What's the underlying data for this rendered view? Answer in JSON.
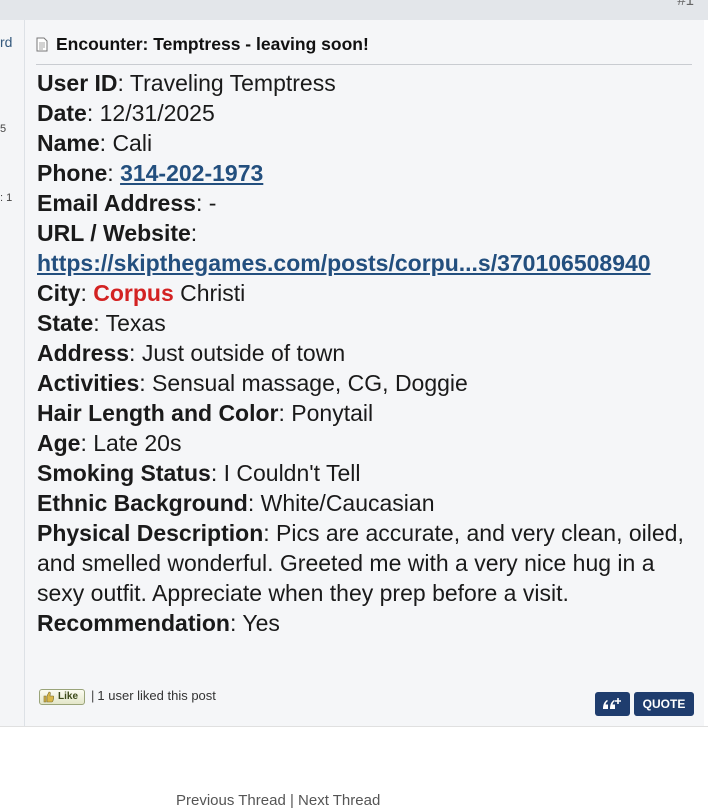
{
  "post": {
    "number": "#1",
    "title": "Encounter: Temptress - leaving soon!",
    "fields": [
      {
        "label": "User ID",
        "value": "Traveling Temptress"
      },
      {
        "label": "Date",
        "value": "12/31/2025"
      },
      {
        "label": "Name",
        "value": "Cali"
      },
      {
        "label": "Phone",
        "value": "314-202-1973"
      },
      {
        "label": "Email Address",
        "value": "-"
      },
      {
        "label": "URL / Website",
        "value": "https://skipthegames.com/posts/corpu...s/370106508940"
      },
      {
        "label": "City",
        "value_highlight": "Corpus",
        "value_rest": "Christi"
      },
      {
        "label": "State",
        "value": "Texas"
      },
      {
        "label": "Address",
        "value": "Just outside of town"
      },
      {
        "label": "Activities",
        "value": "Sensual massage, CG, Doggie"
      },
      {
        "label": "Hair Length and Color",
        "value": "Ponytail"
      },
      {
        "label": "Age",
        "value": "Late 20s"
      },
      {
        "label": "Smoking Status",
        "value": "I Couldn't Tell"
      },
      {
        "label": "Ethnic Background",
        "value": "White/Caucasian"
      },
      {
        "label": "Physical Description",
        "value": "Pics are accurate, and very clean, oiled, and smelled wonderful. Greeted me with a very nice hug in a sexy outfit. Appreciate when they prep before a visit."
      },
      {
        "label": "Recommendation",
        "value": "Yes"
      }
    ],
    "footer": {
      "like_label": "Like",
      "like_count_text": "1 user liked this post",
      "quote_label": "QUOTE"
    }
  },
  "sidebar": {
    "fragment_1": "rd",
    "fragment_2": "5",
    "fragment_3": ": 1"
  },
  "bottom": {
    "cutoff_text": "Previous Thread | Next Thread"
  },
  "colors": {
    "link": "#234f7e",
    "highlight": "#d32222",
    "button": "#1f3d6e"
  }
}
